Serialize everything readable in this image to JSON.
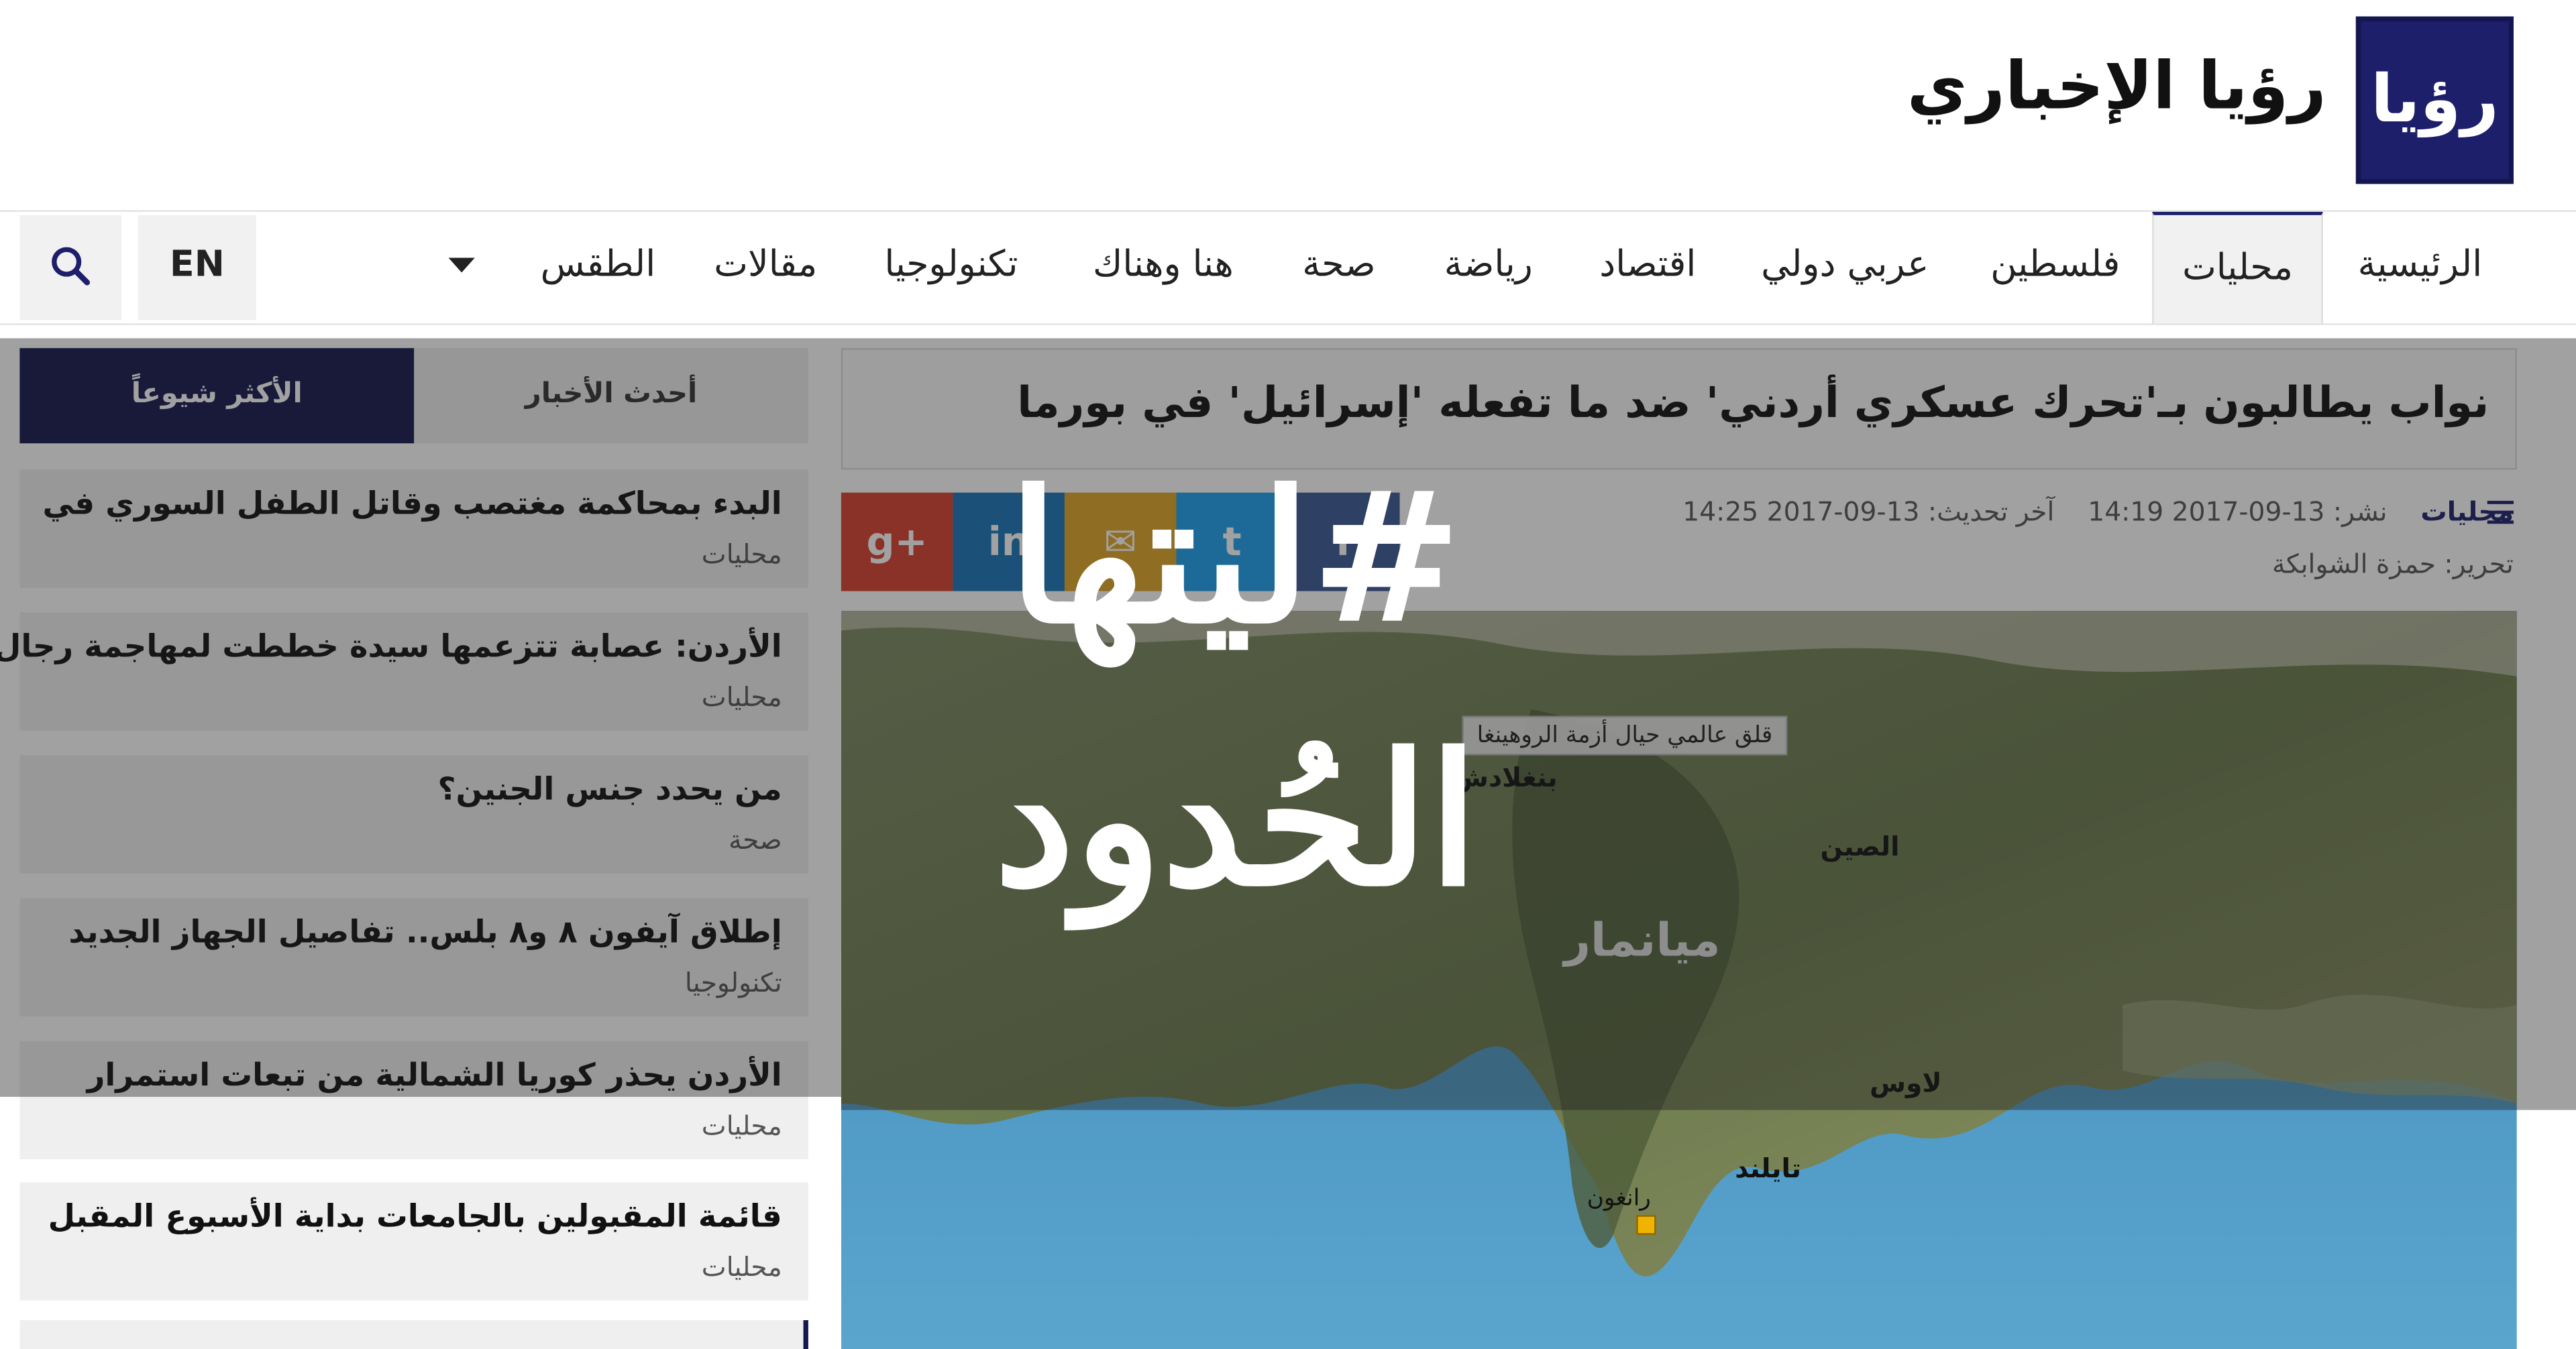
{
  "header": {
    "logo_text": "رؤيا",
    "site_name": "رؤيا الإخباري"
  },
  "nav": {
    "items": [
      "الرئيسية",
      "محليات",
      "فلسطين",
      "عربي دولي",
      "اقتصاد",
      "رياضة",
      "صحة",
      "هنا وهناك",
      "تكنولوجيا",
      "مقالات",
      "الطقس"
    ],
    "active": "محليات",
    "lang_label": "EN"
  },
  "sidebar": {
    "tab_latest": "أحدث الأخبار",
    "tab_popular": "الأكثر شيوعاً",
    "items": [
      {
        "title": "البدء بمحاكمة مغتصب وقاتل الطفل السوري في",
        "category": "محليات"
      },
      {
        "title": "الأردن: عصابة تتزعمها سيدة خططت لمهاجمة رجال",
        "category": "محليات"
      },
      {
        "title": "من يحدد جنس الجنين؟",
        "category": "صحة"
      },
      {
        "title": "إطلاق آيفون ٨ و٨ بلس.. تفاصيل الجهاز الجديد",
        "category": "تكنولوجيا"
      },
      {
        "title": "الأردن يحذر كوريا الشمالية من تبعات استمرار",
        "category": "محليات"
      },
      {
        "title": "قائمة المقبولين بالجامعات بداية الأسبوع المقبل",
        "category": "محليات"
      }
    ]
  },
  "article": {
    "headline": "نواب يطالبون بـ'تحرك عسكري أردني' ضد ما تفعله 'إسرائيل' في بورما",
    "category": "محليات",
    "published": "نشر: 13-09-2017 14:19",
    "updated": "آخر تحديث: 13-09-2017 14:25",
    "author": "تحرير: حمزة الشوابكة",
    "share": {
      "facebook": "f",
      "twitter": "t",
      "email": "✉",
      "linkedin": "in",
      "googleplus": "g+"
    },
    "image": {
      "caption": "قلق عالمي حيال أزمة الروهينغا",
      "labels": {
        "bangladesh": "بنغلادش",
        "china": "الصين",
        "myanmar": "ميانمار",
        "laos": "لاوس",
        "thailand": "تايلند",
        "yangon": "رانغون"
      }
    }
  },
  "overlay": {
    "campaign_line1": "#ليتها",
    "campaign_line2": "الحُدود"
  },
  "colors": {
    "brand": "#1d1f6b",
    "googleplus": "#d9412f",
    "linkedin": "#1976b8",
    "email": "#e0a526",
    "twitter": "#1da1f2",
    "facebook": "#3b5998"
  }
}
